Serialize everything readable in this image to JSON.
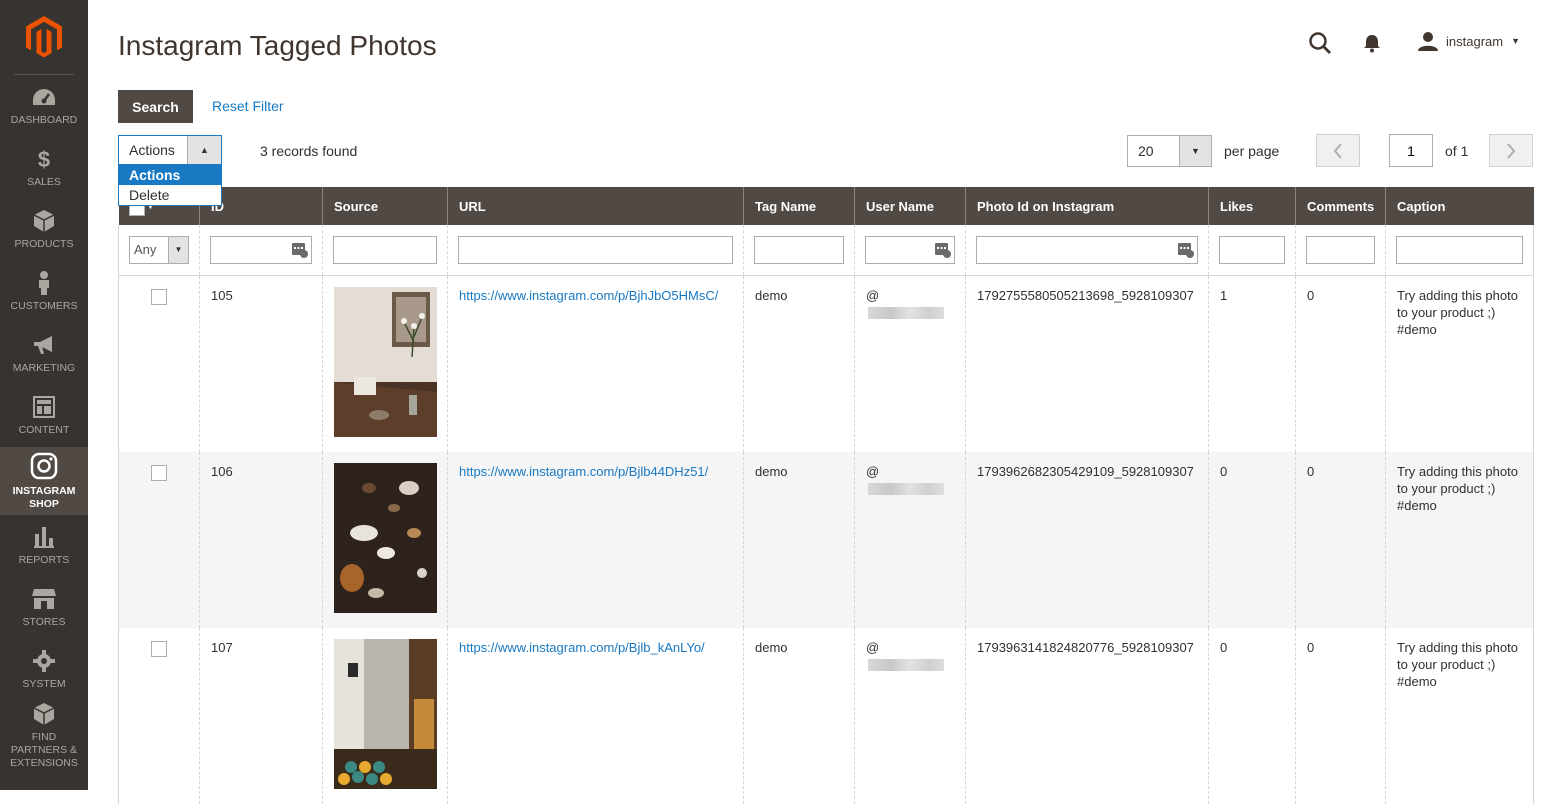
{
  "sidebar": {
    "items": [
      {
        "label": "DASHBOARD",
        "icon": "dashboard-icon"
      },
      {
        "label": "SALES",
        "icon": "dollar-icon"
      },
      {
        "label": "PRODUCTS",
        "icon": "cube-icon"
      },
      {
        "label": "CUSTOMERS",
        "icon": "person-icon"
      },
      {
        "label": "MARKETING",
        "icon": "megaphone-icon"
      },
      {
        "label": "CONTENT",
        "icon": "layout-icon"
      },
      {
        "label": "INSTAGRAM SHOP",
        "icon": "instagram-icon",
        "active": true
      },
      {
        "label": "REPORTS",
        "icon": "bar-chart-icon"
      },
      {
        "label": "STORES",
        "icon": "store-icon"
      },
      {
        "label": "SYSTEM",
        "icon": "gear-icon"
      },
      {
        "label": "FIND PARTNERS & EXTENSIONS",
        "icon": "boxes-icon"
      }
    ]
  },
  "header": {
    "title": "Instagram Tagged Photos",
    "username": "instagram"
  },
  "toolbar": {
    "search_label": "Search",
    "reset_label": "Reset Filter",
    "actions_label": "Actions",
    "actions_options": [
      "Actions",
      "Delete"
    ],
    "records_found": "3 records found",
    "per_page_value": "20",
    "per_page_label": "per page",
    "page_value": "1",
    "page_of": "of 1"
  },
  "grid": {
    "columns": [
      "ID",
      "Source",
      "URL",
      "Tag Name",
      "User Name",
      "Photo Id on Instagram",
      "Likes",
      "Comments",
      "Caption"
    ],
    "filter_any": "Any",
    "rows": [
      {
        "id": "105",
        "url": "https://www.instagram.com/p/BjhJbO5HMsC/",
        "tag": "demo",
        "user_prefix": "@",
        "photo_id": "1792755580505213698_5928109307",
        "likes": "1",
        "comments": "0",
        "caption": "Try adding this photo to your product ;) #demo"
      },
      {
        "id": "106",
        "url": "https://www.instagram.com/p/Bjlb44DHz51/",
        "tag": "demo",
        "user_prefix": "@",
        "photo_id": "1793962682305429109_5928109307",
        "likes": "0",
        "comments": "0",
        "caption": "Try adding this photo to your product ;) #demo"
      },
      {
        "id": "107",
        "url": "https://www.instagram.com/p/Bjlb_kAnLYo/",
        "tag": "demo",
        "user_prefix": "@",
        "photo_id": "1793963141824820776_5928109307",
        "likes": "0",
        "comments": "0",
        "caption": "Try adding this photo to your product ;) #demo"
      }
    ]
  },
  "colors": {
    "sidebar_bg": "#373330",
    "header_bg": "#514943",
    "link": "#1979c3",
    "accent_logo": "#eb5202"
  }
}
